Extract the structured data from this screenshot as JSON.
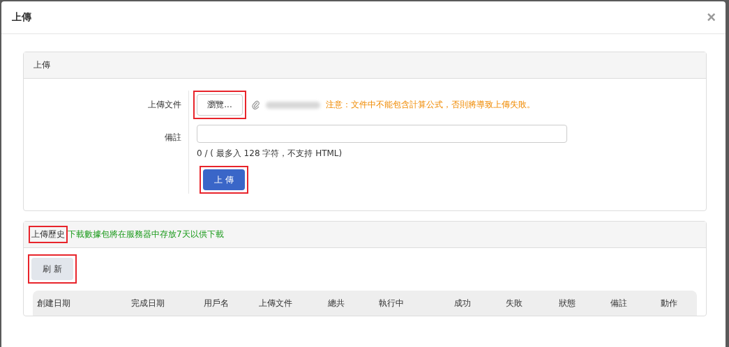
{
  "dialog": {
    "title": "上傳",
    "close": "×"
  },
  "upload_panel": {
    "title": "上傳",
    "file_label": "上傳文件",
    "browse_button": {
      "label": "瀏覽...",
      "highlighted": true
    },
    "warning": "注意：文件中不能包含計算公式，否則將導致上傳失敗。",
    "note_label": "備註",
    "counter": "0 / ( 最多入 128 字符，不支持 HTML)",
    "upload_button": {
      "label": "上 傳",
      "highlighted": true
    }
  },
  "history_panel": {
    "title": {
      "label": "上傳歷史",
      "highlighted": true
    },
    "notice": "下載數據包將在服務器中存放7天以供下載",
    "refresh_button": {
      "label": "刷 新",
      "highlighted": true
    },
    "table": {
      "columns": [
        "創建日期",
        "完成日期",
        "用戶名",
        "上傳文件",
        "總共",
        "執行中",
        "成功",
        "失敗",
        "狀態",
        "備註",
        "動作"
      ]
    }
  }
}
